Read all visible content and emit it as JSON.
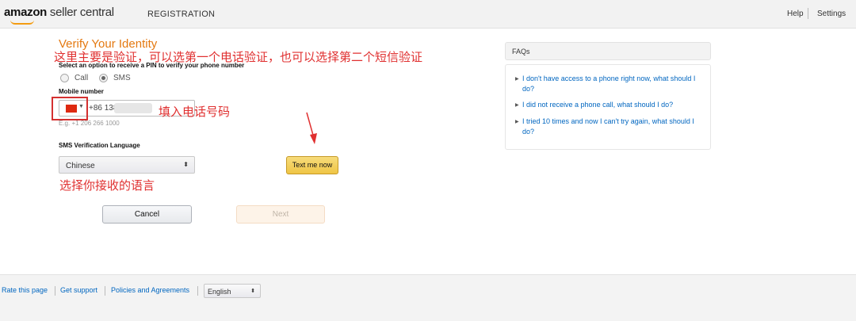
{
  "header": {
    "logo_bold": "amazon",
    "logo_rest": " seller central",
    "registration": "REGISTRATION",
    "help": "Help",
    "settings": "Settings"
  },
  "form": {
    "title": "Verify Your Identity",
    "select_option_label": "Select an option to receive a PIN to verify your phone number",
    "radio_call": "Call",
    "radio_sms": "SMS",
    "selected_option": "SMS",
    "mobile_label": "Mobile number",
    "country_flag_icon": "china-flag-icon",
    "phone_value": "+86 138",
    "phone_example": "E.g. +1 206 266 1000",
    "sms_language_label": "SMS Verification Language",
    "language_value": "Chinese",
    "text_me_button": "Text me now",
    "cancel_button": "Cancel",
    "next_button": "Next"
  },
  "annotations": {
    "main": "这里主要是验证，可以选第一个电话验证，也可以选择第二个短信验证",
    "phone": "填入电话号码",
    "language": "选择你接收的语言",
    "color": "#e03030"
  },
  "faq": {
    "heading": "FAQs",
    "items": [
      "I don't have access to a phone right now, what should I do?",
      "I did not receive a phone call, what should I do?",
      "I tried 10 times and now I can't try again, what should I do?"
    ]
  },
  "footer": {
    "rate": "Rate this page",
    "support": "Get support",
    "policies": "Policies and Agreements",
    "language": "English"
  },
  "colors": {
    "accent": "#e47911",
    "link": "#0066c0",
    "button_yellow": "#f0c14b"
  }
}
